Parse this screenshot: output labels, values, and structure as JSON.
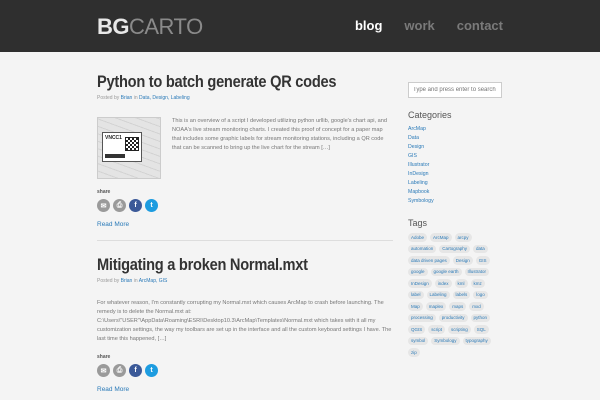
{
  "header": {
    "logo_bold": "BG",
    "logo_light": "CARTO",
    "nav": [
      {
        "label": "blog",
        "active": true
      },
      {
        "label": "work",
        "active": false
      },
      {
        "label": "contact",
        "active": false
      }
    ]
  },
  "posts": [
    {
      "title": "Python to batch generate QR codes",
      "meta_prefix": "Posted by",
      "author": "Brian",
      "meta_in": "in",
      "categories": "Data, Design, Labeling",
      "thumb_label": "VNCC1",
      "excerpt": "This is an overview of a script I developed utilizing python urllib, google's chart api, and NOAA's live stream monitoring charts. I created this proof of concept for a paper map that includes some graphic labels for stream monitoring stations, including a QR code that can be scanned to bring up the live chart for the stream […]",
      "share_label": "share",
      "read_more": "Read More"
    },
    {
      "title": "Mitigating a broken Normal.mxt",
      "meta_prefix": "Posted by",
      "author": "Brian",
      "meta_in": "in",
      "categories": "ArcMap, GIS",
      "excerpt": "For whatever reason, I'm constantly corrupting my Normal.mxt which causes ArcMap to crash before launching. The remedy is to delete the Normal.mxt at: C:\\Users\\\"USER\"\\AppData\\Roaming\\ESRI\\Desktop10.3\\ArcMap\\Templates\\Normal.mxt which takes with it all my customization settings, the way my toolbars are set up in the interface and all the custom keyboard settings I have. The last time this happened, […]",
      "share_label": "share",
      "read_more": "Read More"
    }
  ],
  "sidebar": {
    "search_placeholder": "Type and press enter to search",
    "categories_heading": "Categories",
    "categories": [
      "ArcMap",
      "Data",
      "Design",
      "GIS",
      "Illustrator",
      "InDesign",
      "Labeling",
      "Mapbook",
      "Symbology"
    ],
    "tags_heading": "Tags",
    "tags": [
      "Adobe",
      "ArcMap",
      "arcpy",
      "automation",
      "Cartography",
      "data",
      "data driven pages",
      "Design",
      "GIS",
      "google",
      "google earth",
      "Illustrator",
      "InDesign",
      "index",
      "kml",
      "kmz",
      "label",
      "Labeling",
      "labels",
      "logo",
      "Map",
      "maplex",
      "maps",
      "mxd",
      "processing",
      "productivity",
      "python",
      "QGIS",
      "script",
      "scripting",
      "SQL",
      "symbol",
      "Symbology",
      "typography",
      "zip"
    ]
  }
}
